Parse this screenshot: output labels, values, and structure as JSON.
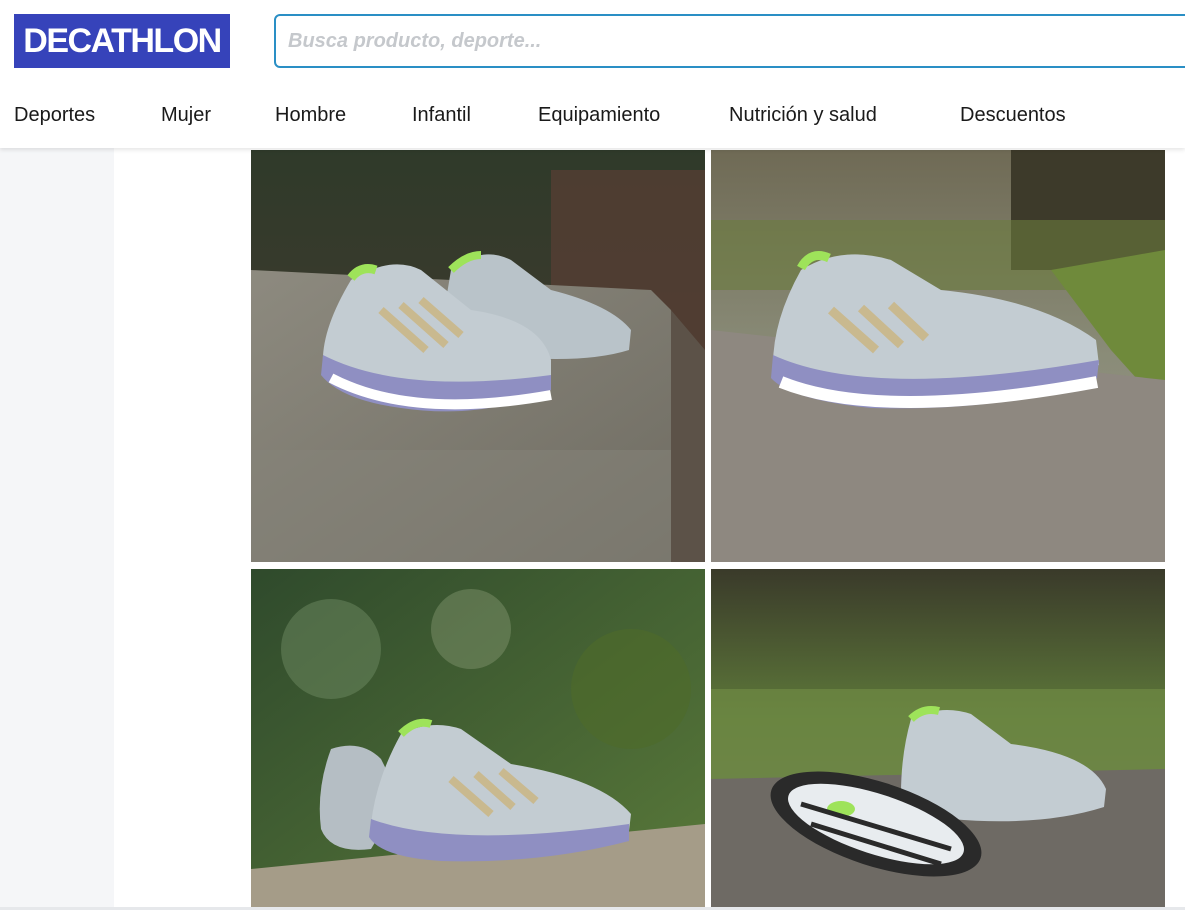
{
  "brand": {
    "logo_text": "DECATHLON",
    "color": "#3643ba"
  },
  "search": {
    "placeholder": "Busca producto, deporte...",
    "value": "",
    "border_color": "#2a8fc5"
  },
  "nav": {
    "items": [
      {
        "label": "Deportes"
      },
      {
        "label": "Mujer"
      },
      {
        "label": "Hombre"
      },
      {
        "label": "Infantil"
      },
      {
        "label": "Equipamiento"
      },
      {
        "label": "Nutrición y salud"
      },
      {
        "label": "Descuentos"
      }
    ]
  },
  "gallery": {
    "images": [
      {
        "name": "shoe-pair-on-stone-ledge"
      },
      {
        "name": "single-shoe-on-path"
      },
      {
        "name": "shoes-on-wall-with-trees"
      },
      {
        "name": "shoe-sole-and-side-on-path"
      }
    ],
    "shoe_colors": {
      "upper": "#b9c3c9",
      "accent": "#9ee35a",
      "stripes": "#c9b98f",
      "midsole": "#8f8fc2"
    }
  }
}
